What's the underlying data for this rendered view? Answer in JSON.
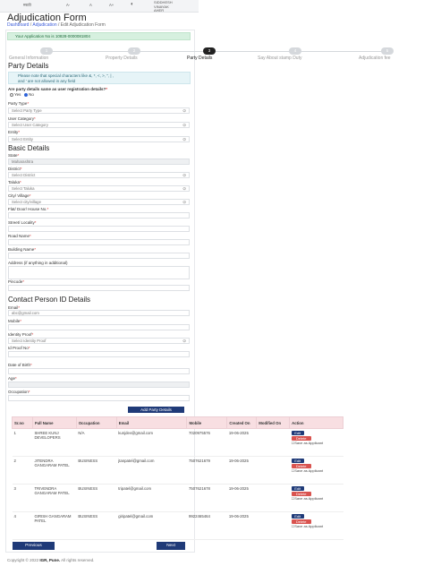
{
  "topbar": {
    "lang": "मराठी",
    "font_minus": "A-",
    "font_normal": "A",
    "font_plus": "A+",
    "user_line1": "SIDDHESH",
    "user_line2": "VINAYAK",
    "user_line3": "AHER"
  },
  "page": {
    "title": "Adjudication Form",
    "breadcrumb_home": "Dashboard",
    "breadcrumb_mid": "Adjudication",
    "breadcrumb_current": "Edit Adjudication Form"
  },
  "app_no": "Your Application No is 10828-0000081804",
  "stepper": {
    "steps": [
      {
        "num": "1",
        "label": "General Information"
      },
      {
        "num": "2",
        "label": "Property Details"
      },
      {
        "num": "3",
        "label": "Party Details"
      },
      {
        "num": "4",
        "label": "Say About stamp Duty"
      },
      {
        "num": "5",
        "label": "Adjudication fee"
      }
    ]
  },
  "party": {
    "section_title": "Party Details",
    "note_line1": "Please note that special characters like &, *, <, >, \", | ,",
    "note_line2": "and ' are not allowed in any field",
    "same_question": "Are party details same as user registration details?",
    "yes": "Yes",
    "no": "No",
    "party_type_label": "Party Type",
    "party_type_value": "Select Party Type",
    "user_category_label": "User Category",
    "user_category_value": "Select User Category",
    "entity_label": "Entity",
    "entity_value": "Select Entity"
  },
  "basic": {
    "section_title": "Basic Details",
    "state_label": "State",
    "state_value": "Maharashtra",
    "district_label": "District",
    "district_value": "Select District",
    "taluka_label": "Taluka",
    "taluka_value": "Select Taluka",
    "city_label": "City/ Village",
    "city_value": "Select city/village",
    "flat_label": "Flat/ Door/ House No.",
    "street_label": "Street/ Locality",
    "road_label": "Road Name",
    "building_label": "Building Name",
    "address_label": "Address (if anything in additional)",
    "pincode_label": "Pincode"
  },
  "contact": {
    "section_title": "Contact Person ID Details",
    "email_label": "Email",
    "email_placeholder": "abc@gmail.com",
    "mobile_label": "Mobile",
    "identity_label": "Identity Proof",
    "identity_value": "Select Identity Proof",
    "idno_label": "Id Proof No",
    "dob_label": "Date of Birth",
    "age_label": "Age",
    "occupation_label": "Occupation",
    "add_button": "Add Party Details"
  },
  "table": {
    "headers": [
      "Sr.no",
      "Full Name",
      "Occupation",
      "Email",
      "Mobile",
      "Created On",
      "Modified On",
      "Action"
    ],
    "rows": [
      {
        "sr": "1",
        "name": "SHREE KUNJ DEVELOPERS",
        "occ": "N/A",
        "email": "kunjdev@gmail.com",
        "mobile": "7020975576",
        "created": "19-06-2025",
        "modified": ""
      },
      {
        "sr": "2",
        "name": "JITENDRA GANGARAM PATEL",
        "occ": "BUSINESS",
        "email": "jtanpatel@gmail.com",
        "mobile": "7507621679",
        "created": "19-06-2025",
        "modified": ""
      },
      {
        "sr": "3",
        "name": "TRIVENDRA GANGARAM PATEL",
        "occ": "BUSINESS",
        "email": "tripatel@gmail.com",
        "mobile": "7507621678",
        "created": "19-06-2025",
        "modified": ""
      },
      {
        "sr": "4",
        "name": "GIRISH GANGARAM PATEL",
        "occ": "BUSINESS",
        "email": "giripatel@gmail.com",
        "mobile": "9922465464",
        "created": "19-06-2025",
        "modified": ""
      }
    ],
    "edit": "Edit",
    "delete": "Delete",
    "save_as": "Save as Applicant"
  },
  "nav": {
    "previous": "Previous",
    "next": "Next"
  },
  "footer": {
    "prefix": "Copyright © 2022",
    "org": "IGR, Pune.",
    "suffix": "All rights reserved."
  }
}
